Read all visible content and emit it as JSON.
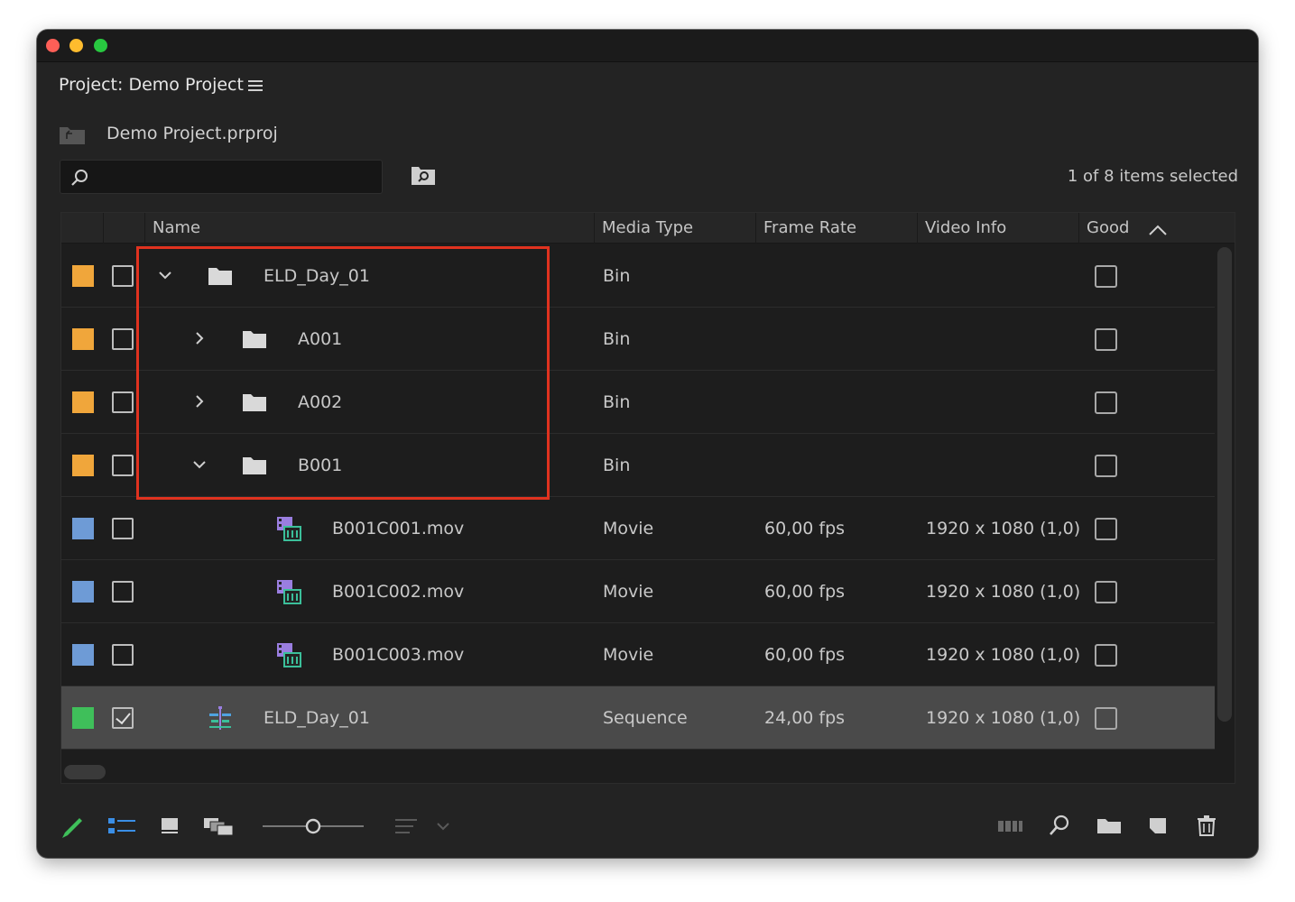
{
  "window": {
    "panel_title": "Project: Demo Project",
    "project_file": "Demo Project.prproj",
    "selection_status": "1 of 8 items selected"
  },
  "search": {
    "value": "",
    "placeholder": ""
  },
  "columns": {
    "name": "Name",
    "media_type": "Media Type",
    "frame_rate": "Frame Rate",
    "video_info": "Video Info",
    "good": "Good"
  },
  "colors": {
    "label_orange": "#f0a63b",
    "label_blue": "#6e9bd6",
    "label_green": "#3fbf5a",
    "highlight_box": "#e0321f"
  },
  "rows": [
    {
      "label_color": "#f0a63b",
      "checked": false,
      "indent": 0,
      "twisty": "expanded",
      "icon": "folder-icon",
      "name": "ELD_Day_01",
      "media_type": "Bin",
      "frame_rate": "",
      "video_info": "",
      "good": false
    },
    {
      "label_color": "#f0a63b",
      "checked": false,
      "indent": 1,
      "twisty": "collapsed",
      "icon": "folder-icon",
      "name": "A001",
      "media_type": "Bin",
      "frame_rate": "",
      "video_info": "",
      "good": false
    },
    {
      "label_color": "#f0a63b",
      "checked": false,
      "indent": 1,
      "twisty": "collapsed",
      "icon": "folder-icon",
      "name": "A002",
      "media_type": "Bin",
      "frame_rate": "",
      "video_info": "",
      "good": false
    },
    {
      "label_color": "#f0a63b",
      "checked": false,
      "indent": 1,
      "twisty": "expanded",
      "icon": "folder-icon",
      "name": "B001",
      "media_type": "Bin",
      "frame_rate": "",
      "video_info": "",
      "good": false
    },
    {
      "label_color": "#6e9bd6",
      "checked": false,
      "indent": 2,
      "twisty": "none",
      "icon": "movie-clip-icon",
      "name": "B001C001.mov",
      "media_type": "Movie",
      "frame_rate": "60,00 fps",
      "video_info": "1920 x 1080 (1,0)",
      "good": false
    },
    {
      "label_color": "#6e9bd6",
      "checked": false,
      "indent": 2,
      "twisty": "none",
      "icon": "movie-clip-icon",
      "name": "B001C002.mov",
      "media_type": "Movie",
      "frame_rate": "60,00 fps",
      "video_info": "1920 x 1080 (1,0)",
      "good": false
    },
    {
      "label_color": "#6e9bd6",
      "checked": false,
      "indent": 2,
      "twisty": "none",
      "icon": "movie-clip-icon",
      "name": "B001C003.mov",
      "media_type": "Movie",
      "frame_rate": "60,00 fps",
      "video_info": "1920 x 1080 (1,0)",
      "good": false
    },
    {
      "label_color": "#3fbf5a",
      "checked": true,
      "indent": 0,
      "twisty": "none",
      "icon": "sequence-icon",
      "name": "ELD_Day_01",
      "media_type": "Sequence",
      "frame_rate": "24,00 fps",
      "video_info": "1920 x 1080 (1,0)",
      "good": false,
      "selected": true
    }
  ],
  "toolbar": {
    "icons": [
      "pencil-icon",
      "list-view-icon",
      "icon-view-icon",
      "freeform-view-icon",
      "zoom-slider",
      "sort-icons-icon",
      "sort-dropdown-icon",
      "automate-to-sequence-icon",
      "find-icon",
      "new-bin-icon",
      "new-item-icon",
      "trash-icon"
    ],
    "zoom_level": 0.5
  }
}
